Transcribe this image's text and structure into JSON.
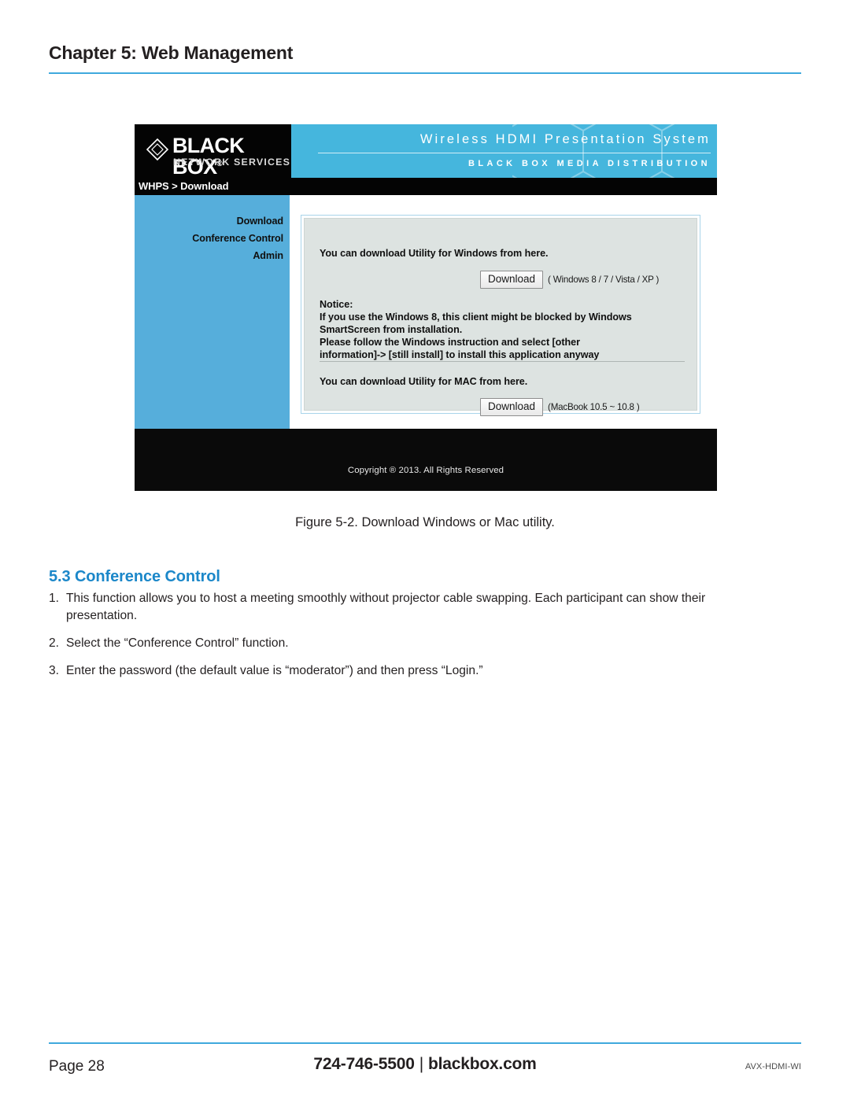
{
  "page": {
    "chapter_title": "Chapter 5: Web Management",
    "figure_caption": "Figure 5-2. Download Windows or Mac utility.",
    "section_heading": "5.3 Conference Control",
    "steps": [
      {
        "num": "1.",
        "text": "This function allows you to host a meeting smoothly without projector cable swapping. Each participant can show their presentation."
      },
      {
        "num": "2.",
        "text": "Select the “Conference Control” function."
      },
      {
        "num": "3.",
        "text": "Enter the password (the default value is “moderator”) and then press “Login.”"
      }
    ],
    "footer": {
      "page_label": "Page 28",
      "phone": "724-746-5500",
      "separator": "|",
      "website": "blackbox.com",
      "model": "AVX-HDMI-WI"
    },
    "accent_color": "#3fa9dd",
    "heading_color": "#1b87c9"
  },
  "screenshot": {
    "logo": {
      "wordmark": "BLACK BOX",
      "registered": "®",
      "tagline": "NETWORK SERVICES"
    },
    "banner": {
      "line1": "Wireless HDMI Presentation System",
      "line2": "BLACK BOX MEDIA DISTRIBUTION",
      "background_color": "#45b6dd"
    },
    "breadcrumb": "WHPS > Download",
    "sidebar": {
      "background_color": "#56aedb",
      "items": [
        {
          "label": "Download"
        },
        {
          "label": "Conference Control"
        },
        {
          "label": "Admin"
        }
      ]
    },
    "content": {
      "windows": {
        "heading": "You can download Utility for Windows from here.",
        "button_label": "Download",
        "note": "( Windows 8 / 7 / Vista / XP )"
      },
      "notice": {
        "title": "Notice:",
        "line1": "If you use the Windows 8, this client might be blocked by Windows",
        "line2": "SmartScreen from installation.",
        "line3": "Please follow the Windows instruction and select [other",
        "line4": "information]-> [still install] to install this application anyway"
      },
      "mac": {
        "heading": "You can download Utility for MAC from here.",
        "button_label": "Download",
        "note": "(MacBook 10.5 ~ 10.8 )"
      }
    },
    "copyright": "Copyright ® 2013. All Rights Reserved"
  }
}
